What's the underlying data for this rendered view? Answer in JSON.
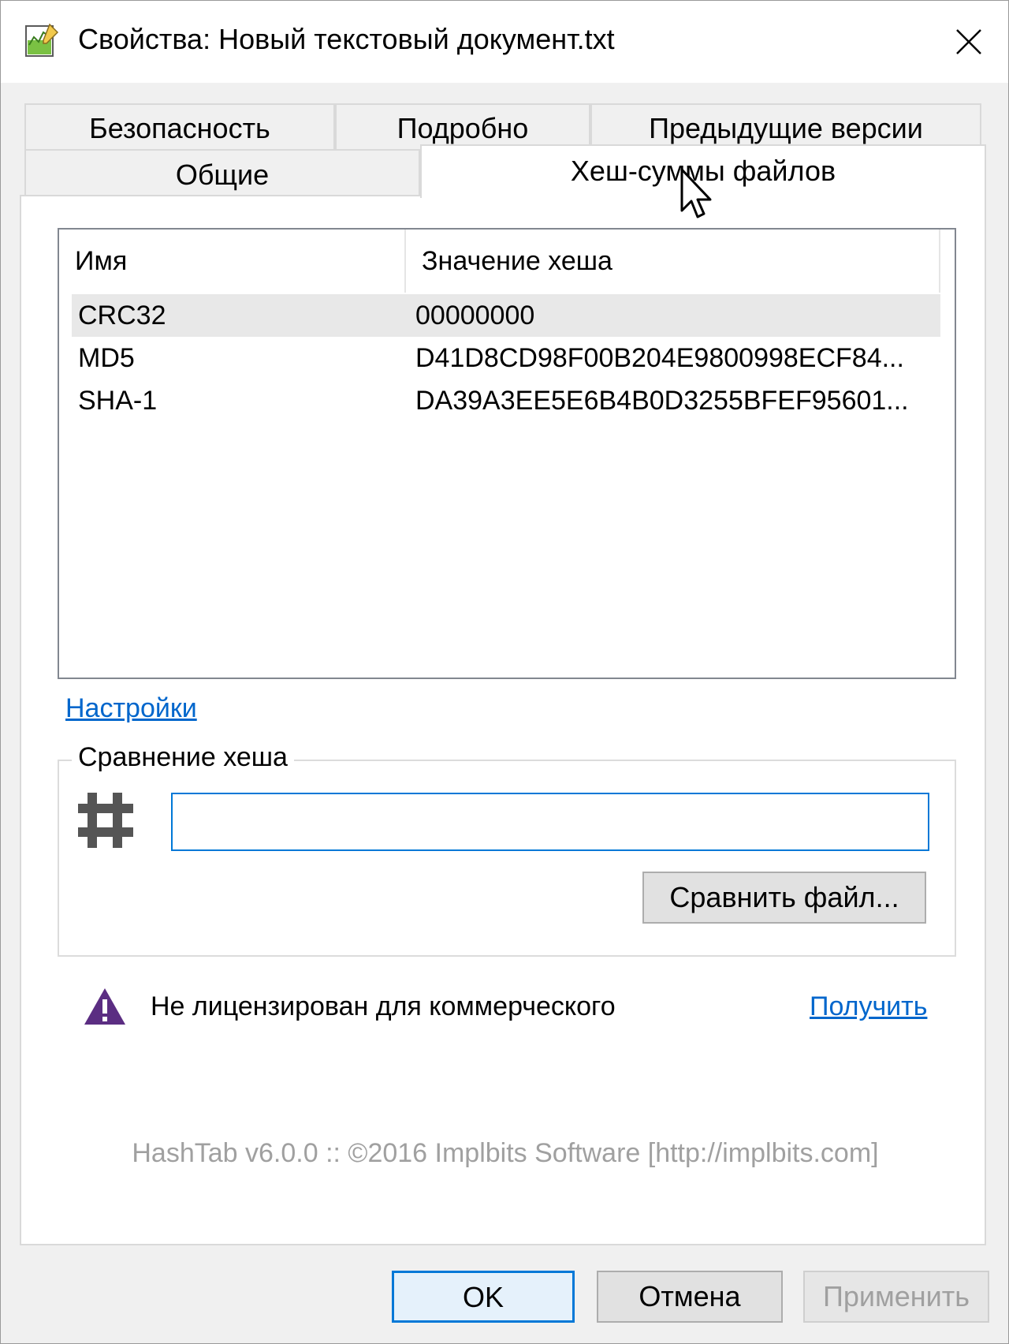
{
  "window": {
    "title": "Свойства: Новый текстовый документ.txt"
  },
  "tabs": {
    "row1": [
      {
        "label": "Безопасность"
      },
      {
        "label": "Подробно"
      },
      {
        "label": "Предыдущие версии"
      }
    ],
    "row2": [
      {
        "label": "Общие"
      },
      {
        "label": "Хеш-суммы файлов",
        "active": true
      }
    ]
  },
  "hash_list": {
    "columns": [
      "Имя",
      "Значение хеша"
    ],
    "rows": [
      {
        "name": "CRC32",
        "value": "00000000",
        "selected": true
      },
      {
        "name": "MD5",
        "value": "D41D8CD98F00B204E9800998ECF84..."
      },
      {
        "name": "SHA-1",
        "value": "DA39A3EE5E6B4B0D3255BFEF95601..."
      }
    ]
  },
  "settings_link": "Настройки",
  "compare": {
    "group_label": "Сравнение хеша",
    "input_value": "",
    "compare_button": "Сравнить файл..."
  },
  "license": {
    "warning_text": "Не лицензирован для коммерческого",
    "get_link": "Получить"
  },
  "footer_text": "HashTab v6.0.0 :: ©2016 Implbits Software [http://implbits.com]",
  "dialog_buttons": {
    "ok": "OK",
    "cancel": "Отмена",
    "apply": "Применить"
  },
  "colors": {
    "accent": "#0078d7",
    "link": "#0066cc",
    "warning_icon": "#5b2d82"
  }
}
